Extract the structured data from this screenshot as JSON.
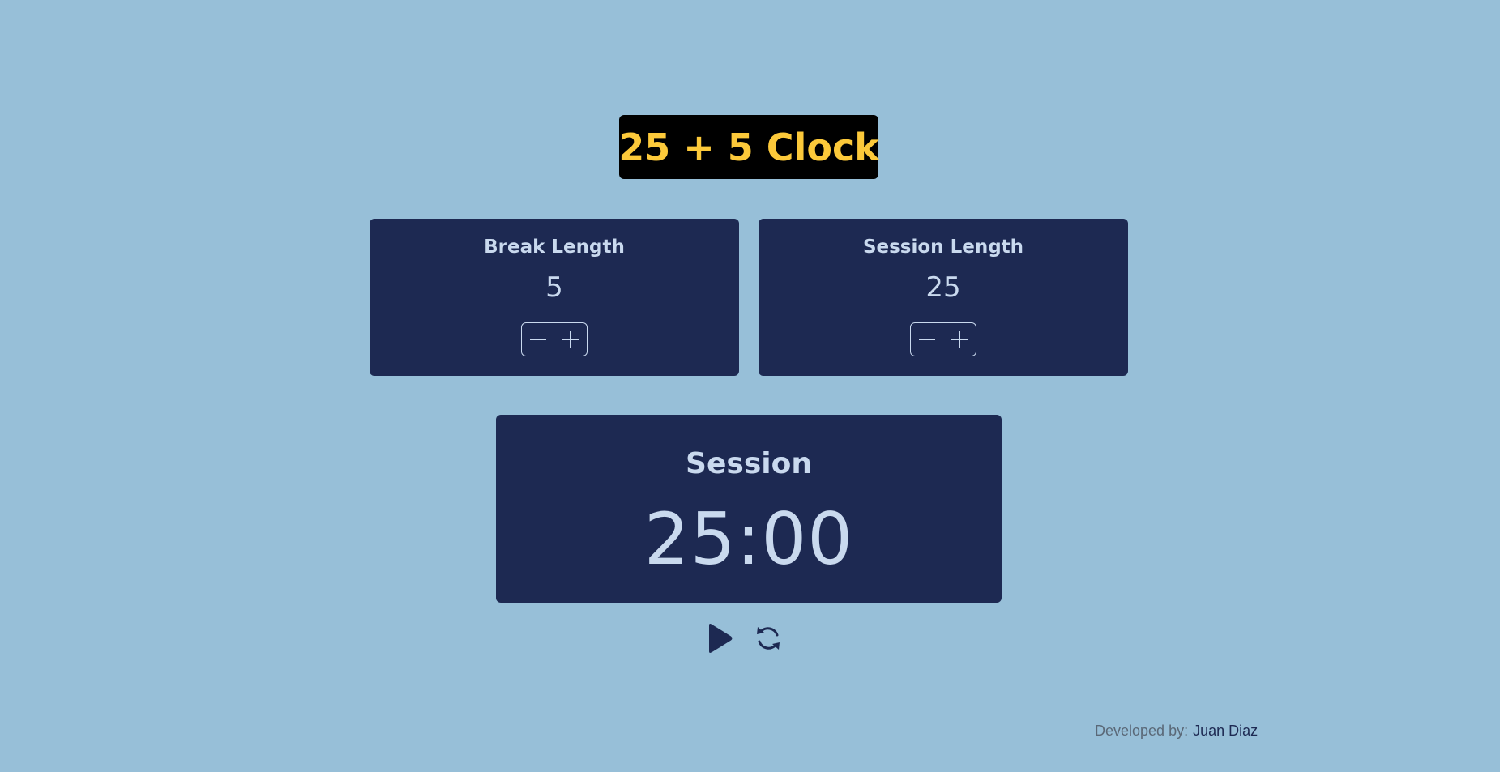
{
  "header": {
    "title": "25 + 5 Clock"
  },
  "break": {
    "label": "Break Length",
    "value": "5"
  },
  "session": {
    "label": "Session Length",
    "value": "25"
  },
  "timer": {
    "label": "Session",
    "time_left": "25:00"
  },
  "controls": {
    "play_icon": "play-icon",
    "reset_icon": "refresh-icon"
  },
  "footer": {
    "label": "Developed by:",
    "name": "Juan Diaz"
  },
  "colors": {
    "background": "#97bfd8",
    "panel": "#1d2952",
    "title_bg": "#000000",
    "title_text": "#fcc93a",
    "panel_text": "#c9d9ee"
  }
}
